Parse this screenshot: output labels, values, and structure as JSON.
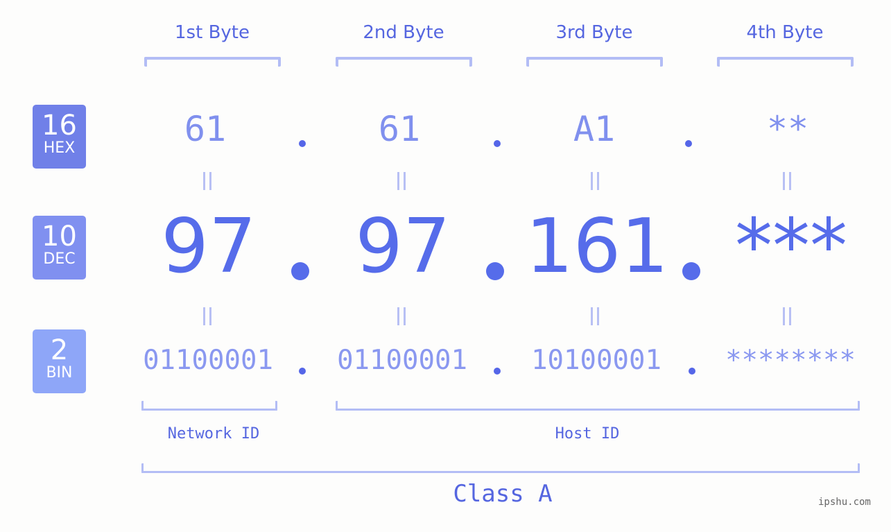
{
  "byte_headers": [
    "1st Byte",
    "2nd Byte",
    "3rd Byte",
    "4th Byte"
  ],
  "bases": [
    {
      "number": "16",
      "label": "HEX",
      "color": "#7080e8"
    },
    {
      "number": "10",
      "label": "DEC",
      "color": "#8090f0"
    },
    {
      "number": "2",
      "label": "BIN",
      "color": "#8ea6f8"
    }
  ],
  "hex": [
    "61",
    "61",
    "A1",
    "**"
  ],
  "dec": [
    "97",
    "97",
    "161",
    "***"
  ],
  "bin": [
    "01100001",
    "01100001",
    "10100001",
    "********"
  ],
  "separator": ".",
  "network_id_label": "Network ID",
  "host_id_label": "Host ID",
  "class_label": "Class A",
  "watermark": "ipshu.com",
  "colors": {
    "accent": "#5566e0",
    "hex_text": "#8090ee",
    "dec_text": "#566cea",
    "bin_text": "#8a98f0",
    "bracket": "#b3bdf5"
  }
}
